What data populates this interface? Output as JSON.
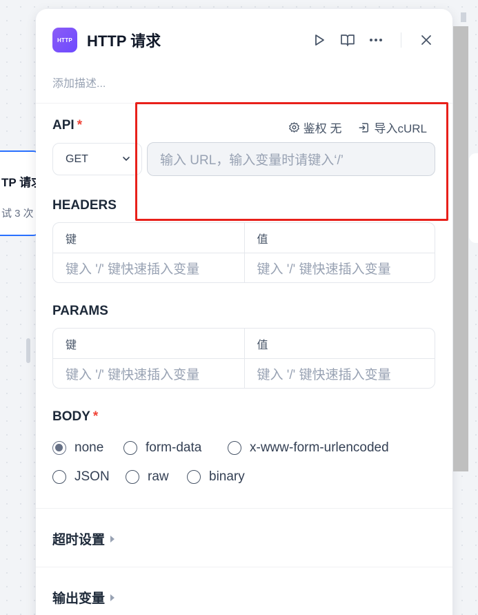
{
  "background": {
    "node_title": "TP 请求",
    "node_subtitle": "试 3 次"
  },
  "header": {
    "icon_text": "HTTP",
    "title": "HTTP 请求"
  },
  "description_placeholder": "添加描述...",
  "api": {
    "label": "API",
    "required_mark": "*",
    "auth_label": "鉴权 无",
    "import_label": "导入cURL",
    "method": "GET",
    "url_placeholder": "输入 URL，输入变量时请键入‘/’"
  },
  "headers": {
    "label": "HEADERS",
    "key_header": "键",
    "value_header": "值",
    "key_placeholder": "键入 '/' 键快速插入变量",
    "value_placeholder": "键入 '/' 键快速插入变量"
  },
  "params": {
    "label": "PARAMS",
    "key_header": "键",
    "value_header": "值",
    "key_placeholder": "键入 '/' 键快速插入变量",
    "value_placeholder": "键入 '/' 键快速插入变量"
  },
  "body": {
    "label": "BODY",
    "required_mark": "*",
    "options": [
      "none",
      "form-data",
      "x-www-form-urlencoded",
      "JSON",
      "raw",
      "binary"
    ],
    "selected": "none"
  },
  "timeout_label": "超时设置",
  "output_label": "输出变量",
  "colors": {
    "highlight": "#e8201a",
    "accent": "#7c5cff",
    "required": "#f04438"
  }
}
